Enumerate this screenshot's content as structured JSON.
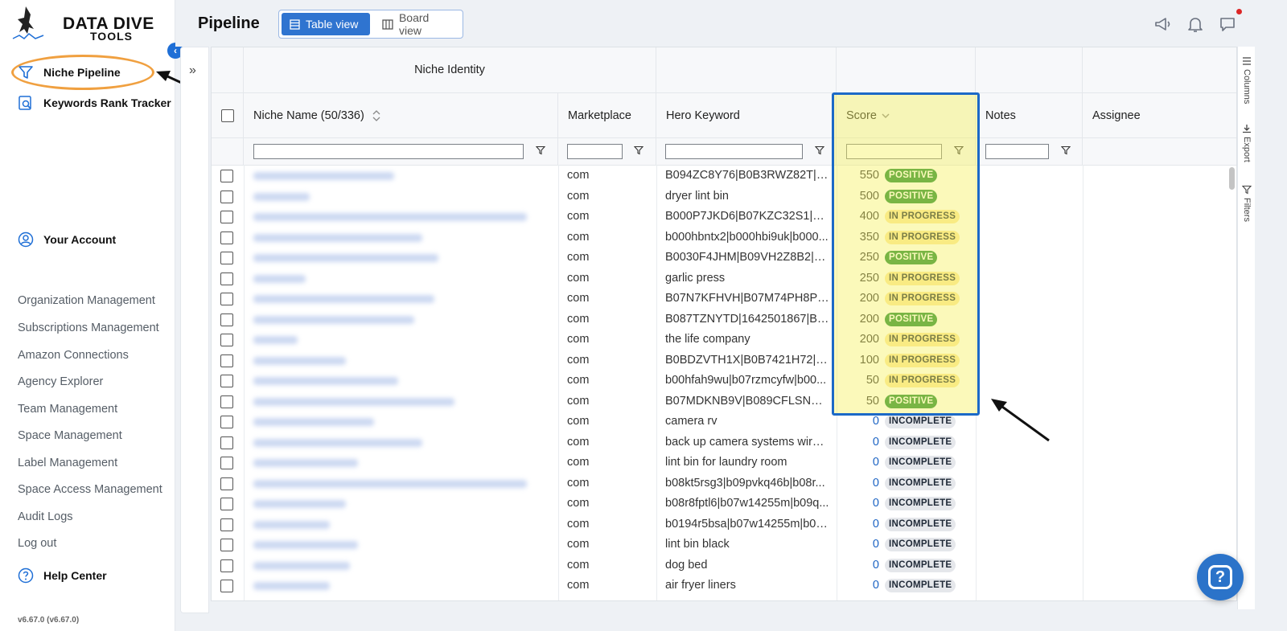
{
  "brand": {
    "name": "DATA DIVE",
    "sub": "TOOLS",
    "mark_text": "DATA DIVE"
  },
  "sidebar": {
    "primary": [
      {
        "label": "Niche Pipeline",
        "icon": "funnel-icon"
      },
      {
        "label": "Keywords Rank Tracker",
        "icon": "chart-search-icon"
      }
    ],
    "account": {
      "label": "Your Account",
      "icon": "user-icon"
    },
    "management": [
      "Organization Management",
      "Subscriptions Management",
      "Amazon Connections",
      "Agency Explorer",
      "Team Management",
      "Space Management",
      "Label Management",
      "Space Access Management",
      "Audit Logs",
      "Log out"
    ],
    "help": {
      "label": "Help Center",
      "icon": "question-circle-icon"
    },
    "version": "v6.67.0 (v6.67.0)"
  },
  "header": {
    "title": "Pipeline",
    "views": [
      {
        "label": "Table view",
        "active": true
      },
      {
        "label": "Board view",
        "active": false
      }
    ],
    "icons": [
      "megaphone-icon",
      "bell-icon",
      "chat-icon"
    ]
  },
  "grid": {
    "group_header": "Niche Identity",
    "columns": {
      "niche_name": "Niche Name (50/336)",
      "marketplace": "Marketplace",
      "hero_keyword": "Hero Keyword",
      "score": "Score",
      "notes": "Notes",
      "assignee": "Assignee"
    },
    "rows": [
      {
        "marketplace": "com",
        "hero": "B094ZC8Y76|B0B3RWZ82T|B0...",
        "score": "550",
        "status": "POSITIVE"
      },
      {
        "marketplace": "com",
        "hero": "dryer lint bin",
        "score": "500",
        "status": "POSITIVE"
      },
      {
        "marketplace": "com",
        "hero": "B000P7JKD6|B07KZC32S1|B07...",
        "score": "400",
        "status": "IN PROGRESS"
      },
      {
        "marketplace": "com",
        "hero": "b000hbntx2|b000hbi9uk|b000...",
        "score": "350",
        "status": "IN PROGRESS"
      },
      {
        "marketplace": "com",
        "hero": "B0030F4JHM|B09VH2Z8B2|B0...",
        "score": "250",
        "status": "POSITIVE"
      },
      {
        "marketplace": "com",
        "hero": "garlic press",
        "score": "250",
        "status": "IN PROGRESS"
      },
      {
        "marketplace": "com",
        "hero": "B07N7KFHVH|B07M74PH8P|B...",
        "score": "200",
        "status": "IN PROGRESS"
      },
      {
        "marketplace": "com",
        "hero": "B087TZNYTD|1642501867|B0...",
        "score": "200",
        "status": "POSITIVE"
      },
      {
        "marketplace": "com",
        "hero": "the life company",
        "score": "200",
        "status": "IN PROGRESS"
      },
      {
        "marketplace": "com",
        "hero": "B0BDZVTH1X|B0B7421H72|B0...",
        "score": "100",
        "status": "IN PROGRESS"
      },
      {
        "marketplace": "com",
        "hero": "b00hfah9wu|b07rzmcyfw|b00...",
        "score": "50",
        "status": "IN PROGRESS"
      },
      {
        "marketplace": "com",
        "hero": "B07MDKNB9V|B089CFLSNN|B...",
        "score": "50",
        "status": "POSITIVE"
      },
      {
        "marketplace": "com",
        "hero": "camera rv",
        "score": "0",
        "status": "INCOMPLETE"
      },
      {
        "marketplace": "com",
        "hero": "back up camera systems wirel...",
        "score": "0",
        "status": "INCOMPLETE"
      },
      {
        "marketplace": "com",
        "hero": "lint bin for laundry room",
        "score": "0",
        "status": "INCOMPLETE"
      },
      {
        "marketplace": "com",
        "hero": "b08kt5rsg3|b09pvkq46b|b08r...",
        "score": "0",
        "status": "INCOMPLETE"
      },
      {
        "marketplace": "com",
        "hero": "b08r8fptl6|b07w14255m|b09q...",
        "score": "0",
        "status": "INCOMPLETE"
      },
      {
        "marketplace": "com",
        "hero": "b0194r5bsa|b07w14255m|b00...",
        "score": "0",
        "status": "INCOMPLETE"
      },
      {
        "marketplace": "com",
        "hero": "lint bin black",
        "score": "0",
        "status": "INCOMPLETE"
      },
      {
        "marketplace": "com",
        "hero": "dog bed",
        "score": "0",
        "status": "INCOMPLETE"
      },
      {
        "marketplace": "com",
        "hero": "air fryer liners",
        "score": "0",
        "status": "INCOMPLETE"
      }
    ]
  },
  "right_bar": [
    "Columns",
    "Export",
    "Filters"
  ],
  "colors": {
    "accent": "#2f74d0",
    "highlight_border": "#1c69c7",
    "positive": "#1f8a34",
    "in_progress": "#fbe7a1",
    "incomplete": "#e5e7eb"
  }
}
